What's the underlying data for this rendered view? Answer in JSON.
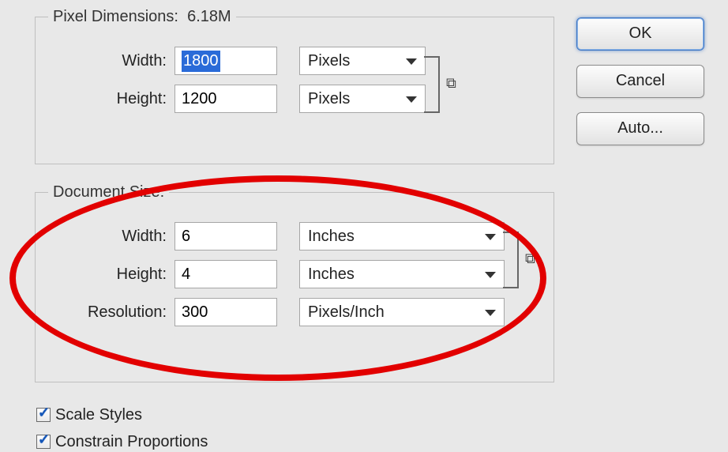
{
  "pixel_dimensions": {
    "legend": "Pixel Dimensions:",
    "size": "6.18M",
    "width_label": "Width:",
    "width_value": "1800",
    "width_unit": "Pixels",
    "height_label": "Height:",
    "height_value": "1200",
    "height_unit": "Pixels"
  },
  "document_size": {
    "legend": "Document Size:",
    "width_label": "Width:",
    "width_value": "6",
    "width_unit": "Inches",
    "height_label": "Height:",
    "height_value": "4",
    "height_unit": "Inches",
    "resolution_label": "Resolution:",
    "resolution_value": "300",
    "resolution_unit": "Pixels/Inch"
  },
  "checks": {
    "scale_styles": "Scale Styles",
    "constrain": "Constrain Proportions"
  },
  "buttons": {
    "ok": "OK",
    "cancel": "Cancel",
    "auto": "Auto..."
  },
  "icons": {
    "link": "⧉"
  }
}
